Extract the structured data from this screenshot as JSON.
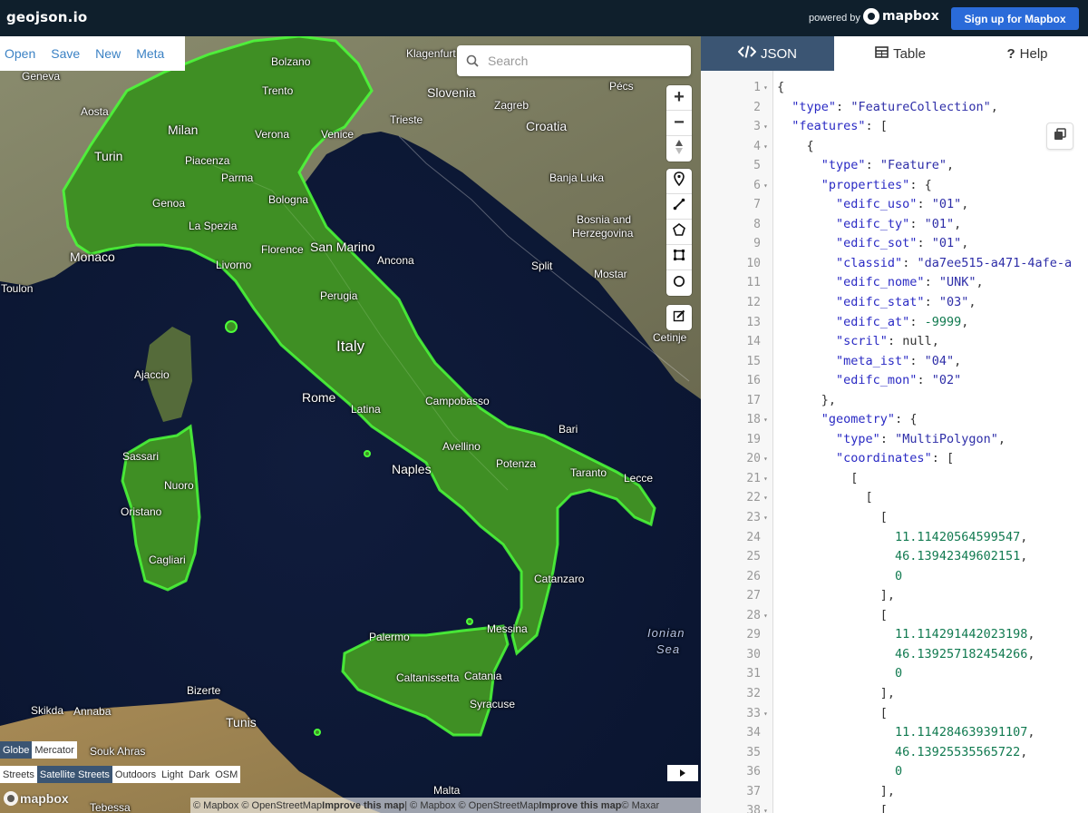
{
  "topbar": {
    "logo": "geojson.io",
    "powered_by": "powered by",
    "mapbox_word": "mapbox",
    "signup": "Sign up for Mapbox"
  },
  "file_menu": [
    "Open",
    "Save",
    "New",
    "Meta"
  ],
  "search": {
    "placeholder": "Search"
  },
  "map_controls": {
    "zoom_in": "+",
    "zoom_out": "−",
    "draw_tools": [
      "marker-icon",
      "line-icon",
      "polygon-icon",
      "rectangle-icon",
      "circle-icon"
    ],
    "edit_tool": "edit-icon"
  },
  "projections": {
    "items": [
      "Globe",
      "Mercator"
    ],
    "active": "Globe"
  },
  "styles": {
    "items": [
      "Streets",
      "Satellite Streets",
      "Outdoors",
      "Light",
      "Dark",
      "OSM"
    ],
    "active": "Satellite Streets"
  },
  "mapbox_watermark": "mapbox",
  "attribution": {
    "part1": "© Mapbox © OpenStreetMap ",
    "improve1": "Improve this map",
    "part2": " | © Mapbox © OpenStreetMap ",
    "improve2": "Improve this map",
    "part3": " © Maxar"
  },
  "map_labels": {
    "geneva": "Geneva",
    "aosta": "Aosta",
    "milan": "Milan",
    "turin": "Turin",
    "genoa": "Genoa",
    "monaco": "Monaco",
    "toulon": "Toulon",
    "bolzano": "Bolzano",
    "trento": "Trento",
    "verona": "Verona",
    "venice": "Venice",
    "piacenza": "Piacenza",
    "parma": "Parma",
    "bologna": "Bologna",
    "la_spezia": "La Spezia",
    "florence": "Florence",
    "san_marino": "San Marino",
    "livorno": "Livorno",
    "ancona": "Ancona",
    "perugia": "Perugia",
    "italy": "Italy",
    "ajaccio": "Ajaccio",
    "rome": "Rome",
    "latina": "Latina",
    "campobasso": "Campobasso",
    "bari": "Bari",
    "avellino": "Avellino",
    "naples": "Naples",
    "potenza": "Potenza",
    "taranto": "Taranto",
    "lecce": "Lecce",
    "sassari": "Sassari",
    "nuoro": "Nuoro",
    "oristano": "Oristano",
    "cagliari": "Cagliari",
    "catanzaro": "Catanzaro",
    "palermo": "Palermo",
    "messina": "Messina",
    "caltanissetta": "Caltanissetta",
    "catania": "Catania",
    "syracuse": "Syracuse",
    "ionian_sea_1": "Ionian",
    "ionian_sea_2": "Sea",
    "bizerte": "Bizerte",
    "tunis": "Tunis",
    "skikda": "Skikda",
    "annaba": "Annaba",
    "souk_ahras": "Souk Ahras",
    "tebessa": "Tebessa",
    "malta": "Malta",
    "klagenfurt": "Klagenfurt",
    "slovenia": "Slovenia",
    "zagreb": "Zagreb",
    "trieste": "Trieste",
    "pecs": "Pécs",
    "croatia": "Croatia",
    "banja_luka": "Banja Luka",
    "bosnia_1": "Bosnia and",
    "bosnia_2": "Herzegovina",
    "split": "Split",
    "mostar": "Mostar",
    "mo": "Mo",
    "cetinje": "Cetinje"
  },
  "tabs": [
    {
      "label": "JSON",
      "icon": "code-icon",
      "active": true
    },
    {
      "label": "Table",
      "icon": "table-icon",
      "active": false
    },
    {
      "label": "Help",
      "icon": "help-icon",
      "active": false
    }
  ],
  "editor": {
    "lines": [
      {
        "n": "1",
        "fold": true
      },
      {
        "n": "2",
        "fold": false
      },
      {
        "n": "3",
        "fold": true
      },
      {
        "n": "4",
        "fold": true
      },
      {
        "n": "5",
        "fold": false
      },
      {
        "n": "6",
        "fold": true
      },
      {
        "n": "7",
        "fold": false
      },
      {
        "n": "8",
        "fold": false
      },
      {
        "n": "9",
        "fold": false
      },
      {
        "n": "10",
        "fold": false
      },
      {
        "n": "11",
        "fold": false
      },
      {
        "n": "12",
        "fold": false
      },
      {
        "n": "13",
        "fold": false
      },
      {
        "n": "14",
        "fold": false
      },
      {
        "n": "15",
        "fold": false
      },
      {
        "n": "16",
        "fold": false
      },
      {
        "n": "17",
        "fold": false
      },
      {
        "n": "18",
        "fold": true
      },
      {
        "n": "19",
        "fold": false
      },
      {
        "n": "20",
        "fold": true
      },
      {
        "n": "21",
        "fold": true
      },
      {
        "n": "22",
        "fold": true
      },
      {
        "n": "23",
        "fold": true
      },
      {
        "n": "24",
        "fold": false
      },
      {
        "n": "25",
        "fold": false
      },
      {
        "n": "26",
        "fold": false
      },
      {
        "n": "27",
        "fold": false
      },
      {
        "n": "28",
        "fold": true
      },
      {
        "n": "29",
        "fold": false
      },
      {
        "n": "30",
        "fold": false
      },
      {
        "n": "31",
        "fold": false
      },
      {
        "n": "32",
        "fold": false
      },
      {
        "n": "33",
        "fold": true
      },
      {
        "n": "34",
        "fold": false
      },
      {
        "n": "35",
        "fold": false
      },
      {
        "n": "36",
        "fold": false
      },
      {
        "n": "37",
        "fold": false
      },
      {
        "n": "38",
        "fold": true
      }
    ],
    "code": [
      [
        [
          "p",
          "{"
        ]
      ],
      [
        [
          "p",
          "  "
        ],
        [
          "k",
          "\"type\""
        ],
        [
          "p",
          ": "
        ],
        [
          "s",
          "\"FeatureCollection\""
        ],
        [
          "p",
          ","
        ]
      ],
      [
        [
          "p",
          "  "
        ],
        [
          "k",
          "\"features\""
        ],
        [
          "p",
          ": ["
        ]
      ],
      [
        [
          "p",
          "    {"
        ]
      ],
      [
        [
          "p",
          "      "
        ],
        [
          "k",
          "\"type\""
        ],
        [
          "p",
          ": "
        ],
        [
          "s",
          "\"Feature\""
        ],
        [
          "p",
          ","
        ]
      ],
      [
        [
          "p",
          "      "
        ],
        [
          "k",
          "\"properties\""
        ],
        [
          "p",
          ": {"
        ]
      ],
      [
        [
          "p",
          "        "
        ],
        [
          "k",
          "\"edifc_uso\""
        ],
        [
          "p",
          ": "
        ],
        [
          "s",
          "\"01\""
        ],
        [
          "p",
          ","
        ]
      ],
      [
        [
          "p",
          "        "
        ],
        [
          "k",
          "\"edifc_ty\""
        ],
        [
          "p",
          ": "
        ],
        [
          "s",
          "\"01\""
        ],
        [
          "p",
          ","
        ]
      ],
      [
        [
          "p",
          "        "
        ],
        [
          "k",
          "\"edifc_sot\""
        ],
        [
          "p",
          ": "
        ],
        [
          "s",
          "\"01\""
        ],
        [
          "p",
          ","
        ]
      ],
      [
        [
          "p",
          "        "
        ],
        [
          "k",
          "\"classid\""
        ],
        [
          "p",
          ": "
        ],
        [
          "s",
          "\"da7ee515-a471-4afe-a"
        ]
      ],
      [
        [
          "p",
          "        "
        ],
        [
          "k",
          "\"edifc_nome\""
        ],
        [
          "p",
          ": "
        ],
        [
          "s",
          "\"UNK\""
        ],
        [
          "p",
          ","
        ]
      ],
      [
        [
          "p",
          "        "
        ],
        [
          "k",
          "\"edifc_stat\""
        ],
        [
          "p",
          ": "
        ],
        [
          "s",
          "\"03\""
        ],
        [
          "p",
          ","
        ]
      ],
      [
        [
          "p",
          "        "
        ],
        [
          "k",
          "\"edifc_at\""
        ],
        [
          "p",
          ": "
        ],
        [
          "n",
          "-9999"
        ],
        [
          "p",
          ","
        ]
      ],
      [
        [
          "p",
          "        "
        ],
        [
          "k",
          "\"scril\""
        ],
        [
          "p",
          ": "
        ],
        [
          "p",
          "null"
        ],
        [
          "p",
          ","
        ]
      ],
      [
        [
          "p",
          "        "
        ],
        [
          "k",
          "\"meta_ist\""
        ],
        [
          "p",
          ": "
        ],
        [
          "s",
          "\"04\""
        ],
        [
          "p",
          ","
        ]
      ],
      [
        [
          "p",
          "        "
        ],
        [
          "k",
          "\"edifc_mon\""
        ],
        [
          "p",
          ": "
        ],
        [
          "s",
          "\"02\""
        ]
      ],
      [
        [
          "p",
          "      },"
        ]
      ],
      [
        [
          "p",
          "      "
        ],
        [
          "k",
          "\"geometry\""
        ],
        [
          "p",
          ": {"
        ]
      ],
      [
        [
          "p",
          "        "
        ],
        [
          "k",
          "\"type\""
        ],
        [
          "p",
          ": "
        ],
        [
          "s",
          "\"MultiPolygon\""
        ],
        [
          "p",
          ","
        ]
      ],
      [
        [
          "p",
          "        "
        ],
        [
          "k",
          "\"coordinates\""
        ],
        [
          "p",
          ": ["
        ]
      ],
      [
        [
          "p",
          "          ["
        ]
      ],
      [
        [
          "p",
          "            ["
        ]
      ],
      [
        [
          "p",
          "              ["
        ]
      ],
      [
        [
          "p",
          "                "
        ],
        [
          "n",
          "11.11420564599547"
        ],
        [
          "p",
          ","
        ]
      ],
      [
        [
          "p",
          "                "
        ],
        [
          "n",
          "46.13942349602151"
        ],
        [
          "p",
          ","
        ]
      ],
      [
        [
          "p",
          "                "
        ],
        [
          "n",
          "0"
        ]
      ],
      [
        [
          "p",
          "              ],"
        ]
      ],
      [
        [
          "p",
          "              ["
        ]
      ],
      [
        [
          "p",
          "                "
        ],
        [
          "n",
          "11.114291442023198"
        ],
        [
          "p",
          ","
        ]
      ],
      [
        [
          "p",
          "                "
        ],
        [
          "n",
          "46.139257182454266"
        ],
        [
          "p",
          ","
        ]
      ],
      [
        [
          "p",
          "                "
        ],
        [
          "n",
          "0"
        ]
      ],
      [
        [
          "p",
          "              ],"
        ]
      ],
      [
        [
          "p",
          "              ["
        ]
      ],
      [
        [
          "p",
          "                "
        ],
        [
          "n",
          "11.114284639391107"
        ],
        [
          "p",
          ","
        ]
      ],
      [
        [
          "p",
          "                "
        ],
        [
          "n",
          "46.13925535565722"
        ],
        [
          "p",
          ","
        ]
      ],
      [
        [
          "p",
          "                "
        ],
        [
          "n",
          "0"
        ]
      ],
      [
        [
          "p",
          "              ],"
        ]
      ],
      [
        [
          "p",
          "              ["
        ]
      ]
    ]
  }
}
